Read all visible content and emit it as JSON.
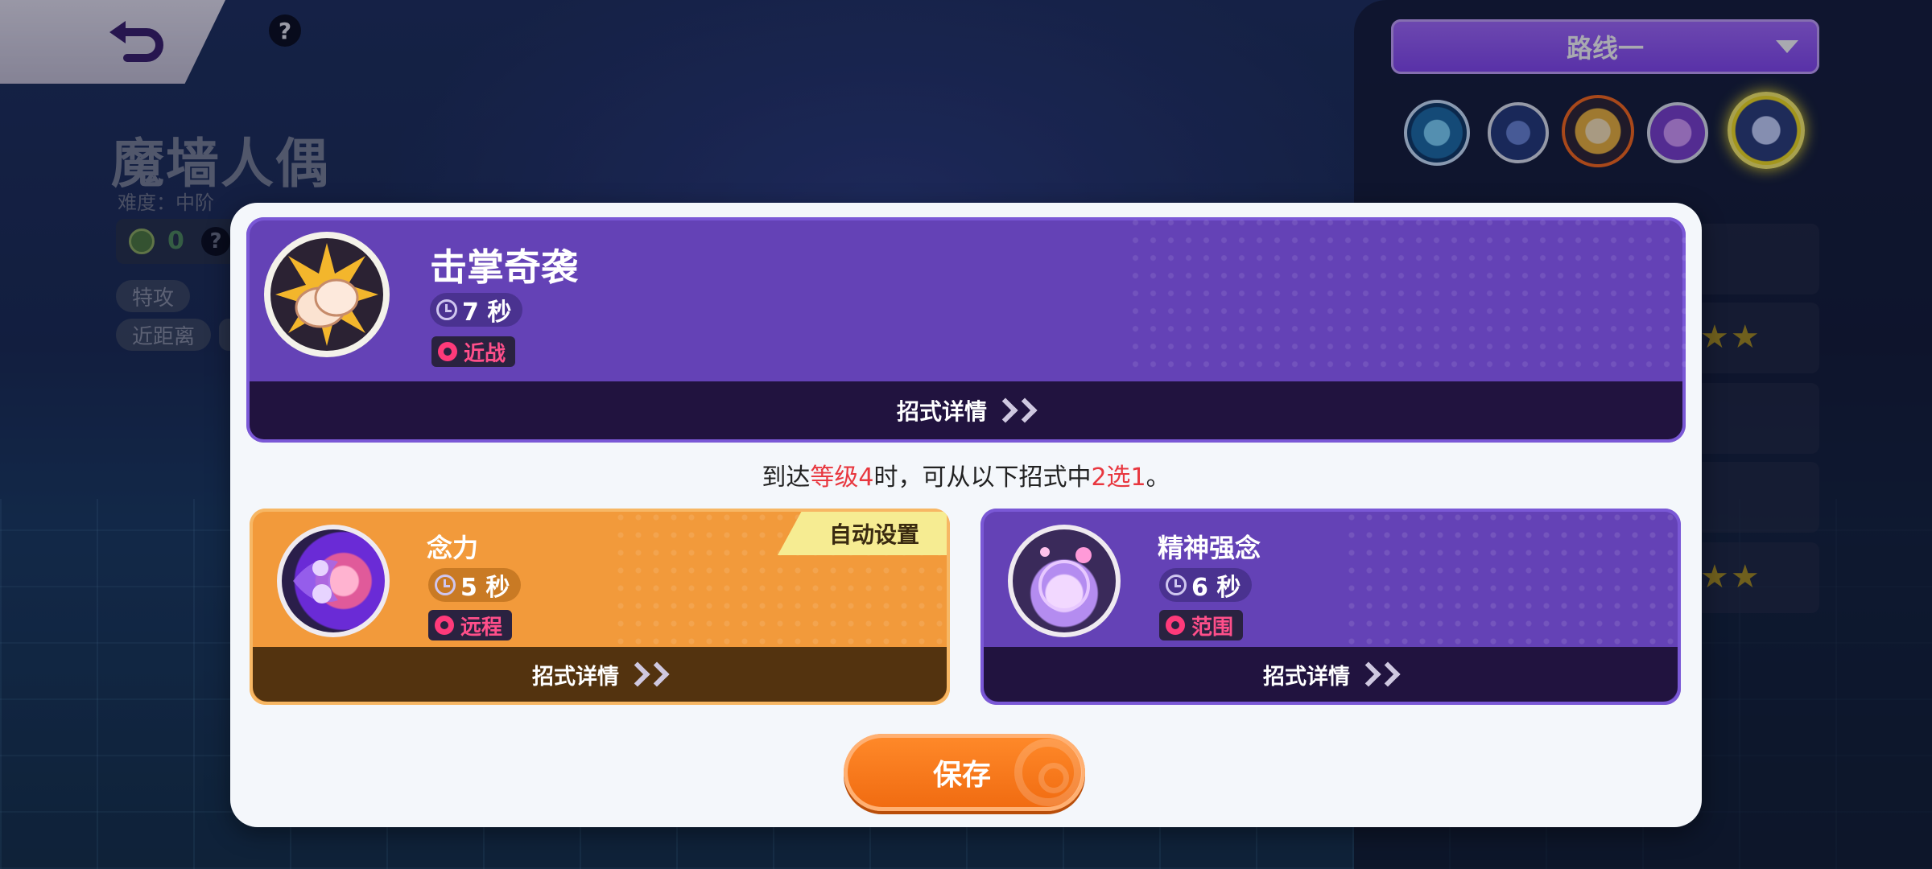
{
  "background": {
    "pokemon_name": "魔墙人偶",
    "difficulty": "难度：中阶",
    "score": "0",
    "help_symbol": "?",
    "tags": [
      "特攻",
      "近距离"
    ]
  },
  "route": {
    "selected": "路线一",
    "slots": [
      "special-ability-icon",
      "unite-move-icon",
      "covet-slap-icon",
      "wall-move-icon",
      "unite-burst-icon"
    ]
  },
  "modal": {
    "main_move": {
      "name": "击掌奇袭",
      "cooldown": "7 秒",
      "type": "近战",
      "details_label": "招式详情"
    },
    "notice": {
      "prefix": "到达",
      "level_text": "等级4",
      "middle": "时，可从以下招式中",
      "choice_text": "2选1",
      "suffix": "。"
    },
    "options": [
      {
        "name": "念力",
        "cooldown": "5 秒",
        "type": "远程",
        "details_label": "招式详情",
        "badge": "自动设置",
        "color": "#f29a3b"
      },
      {
        "name": "精神强念",
        "cooldown": "6 秒",
        "type": "范围",
        "details_label": "招式详情",
        "color": "#6442b6"
      }
    ],
    "save_label": "保存"
  },
  "colors": {
    "accent_purple": "#6442b6",
    "accent_orange": "#f29a3b",
    "save_orange": "#f06a10",
    "highlight_red": "#e8373f",
    "type_pink": "#ff4f8a"
  }
}
